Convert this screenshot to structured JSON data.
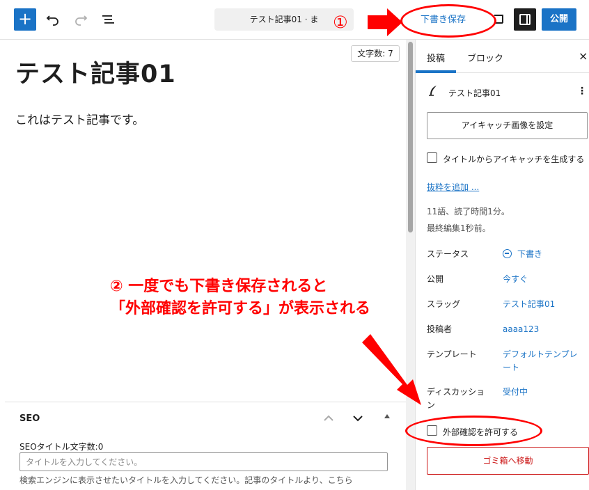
{
  "toolbar": {
    "add_label": "+",
    "undo_icon": "undo-icon",
    "redo_icon": "redo-icon",
    "list_view_icon": "list-view-icon",
    "document_title": "テスト記事01 · ま",
    "save_draft_label": "下書き保存",
    "preview_icon": "preview-icon",
    "settings_icon": "sidebar-toggle-icon",
    "publish_label": "公開",
    "accent_color": "#1a73c6"
  },
  "editor": {
    "title": "テスト記事01",
    "body": "これはテスト記事です。",
    "char_count": "文字数: 7"
  },
  "seo": {
    "heading": "SEO",
    "title_count_label": "SEOタイトル文字数:0",
    "title_placeholder": "タイトルを入力してください。",
    "help_text": "検索エンジンに表示させたいタイトルを入力してください。記事のタイトルより、こちら"
  },
  "sidebar": {
    "tab_post": "投稿",
    "tab_block": "ブロック",
    "close_label": "×",
    "post_title": "テスト記事01",
    "post_icon": "feather-icon",
    "featured_image_button": "アイキャッチ画像を設定",
    "generate_featured_label": "タイトルからアイキャッチを生成する",
    "add_excerpt": "抜粋を追加 ...",
    "stats_words": "11語、読了時間1分。",
    "stats_last_edit": "最終編集1秒前。",
    "rows": [
      {
        "label": "ステータス",
        "value": "下書き"
      },
      {
        "label": "公開",
        "value": "今すぐ"
      },
      {
        "label": "スラッグ",
        "value": "テスト記事01"
      },
      {
        "label": "投稿者",
        "value": "aaaa123"
      },
      {
        "label": "テンプレート",
        "value": "デフォルトテンプレート"
      },
      {
        "label": "ディスカッション",
        "value": "受付中"
      }
    ],
    "external_preview_label": "外部確認を許可する",
    "trash_button": "ゴミ箱へ移動",
    "danger_color": "#cc1818"
  },
  "annotations": {
    "marker_1": "①",
    "marker_2_line1": "② 一度でも下書き保存されると",
    "marker_2_line2": "「外部確認を許可する」が表示される",
    "color": "#ff0000"
  }
}
